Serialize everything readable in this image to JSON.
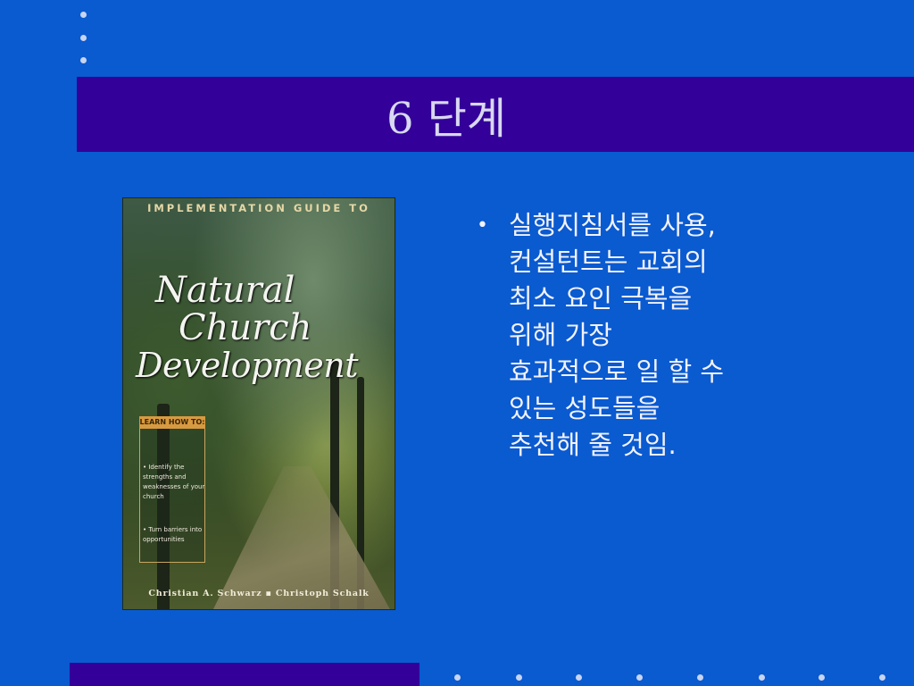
{
  "slide": {
    "title": "6 단계",
    "bullets": [
      {
        "marker": "•",
        "text": "실행지침서를 사용,\n컨설턴트는 교회의\n최소 요인 극복을\n위해 가장\n효과적으로 일 할 수\n있는 성도들을\n추천해 줄 것임."
      }
    ]
  },
  "book": {
    "top_line": "IMPLEMENTATION GUIDE TO",
    "title_line1": "Natural",
    "title_line2": "Church",
    "title_line3": "Development",
    "learn_label": "LEARN HOW TO:",
    "learn_items": [
      "• Identify the strengths and weaknesses of your church",
      "• Turn barriers into opportunities"
    ],
    "authors": "Christian A. Schwarz ▪ Christoph Schalk"
  },
  "colors": {
    "background": "#0a5ad0",
    "title_bar": "#330099",
    "dot": "#c8d4f0",
    "text": "#f2f2fa"
  }
}
